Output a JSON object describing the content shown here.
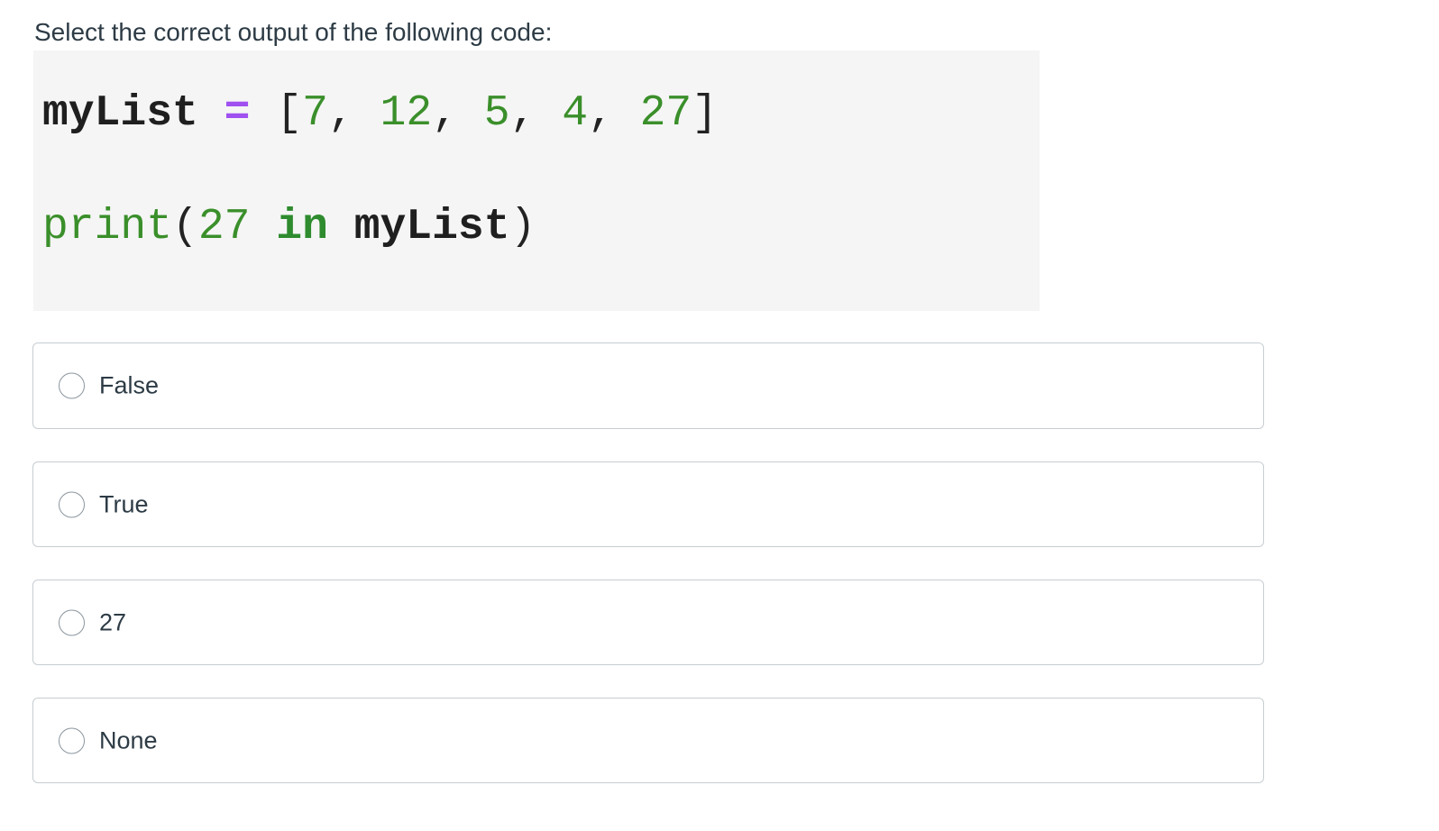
{
  "question": {
    "text": "Select the correct output of the following code:"
  },
  "code": {
    "line1": {
      "var": "myList",
      "op": "=",
      "open": "[",
      "items": [
        "7",
        "12",
        "5",
        "4",
        "27"
      ],
      "sep": ",",
      "close": "]"
    },
    "line2": {
      "fn": "print",
      "open": "(",
      "arg": "27",
      "kw": "in",
      "name": "myList",
      "close": ")"
    }
  },
  "answers": [
    {
      "label": "False",
      "selected": false
    },
    {
      "label": "True",
      "selected": false
    },
    {
      "label": "27",
      "selected": false
    },
    {
      "label": "None",
      "selected": false
    }
  ],
  "colors": {
    "number": "#3a8f2a",
    "operator": "#a050f0",
    "code_bg": "#f5f5f5",
    "border": "#c7cdd1",
    "text": "#2d3b45"
  }
}
